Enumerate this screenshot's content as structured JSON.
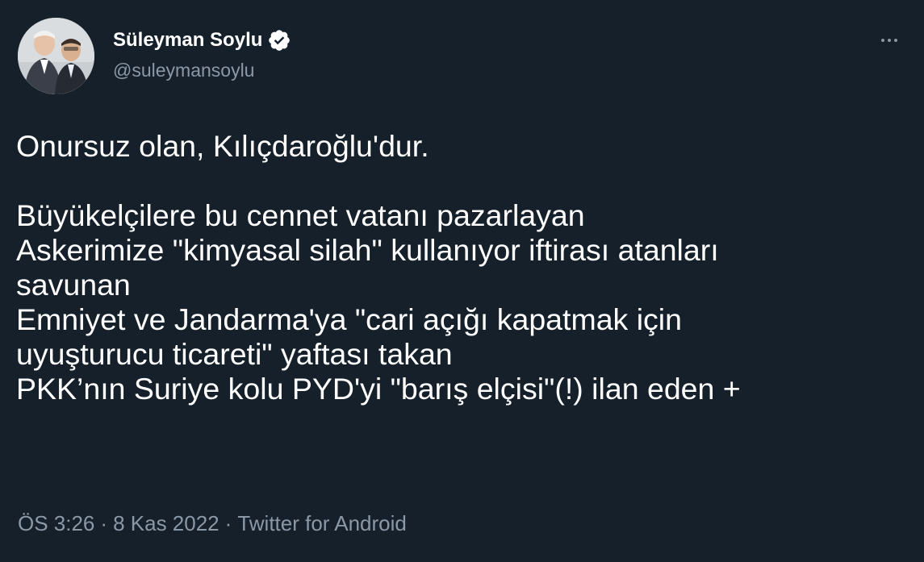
{
  "author": {
    "display_name": "Süleyman Soylu",
    "handle": "@suleymansoylu",
    "verified_icon": "verified-badge-icon",
    "avatar_icon": "profile-photo"
  },
  "tweet": {
    "lines": [
      "Onursuz olan, Kılıçdaroğlu'dur.",
      "",
      "Büyükelçilere bu cennet vatanı pazarlayan",
      "Askerimize \"kimyasal silah\" kullanıyor iftirası atanları",
      "savunan",
      "Emniyet ve Jandarma'ya \"cari açığı kapatmak için",
      "uyuşturucu ticareti\" yaftası takan",
      "PKK’nın Suriye kolu PYD'yi \"barış elçisi\"(!) ilan eden +"
    ]
  },
  "meta": {
    "time": "ÖS 3:26",
    "separator": "·",
    "date": "8 Kas 2022",
    "source": "Twitter for Android"
  },
  "colors": {
    "background": "#15202b",
    "primary_text": "#ffffff",
    "secondary_text": "#8b98a5",
    "verified_badge": "#ffffff"
  }
}
